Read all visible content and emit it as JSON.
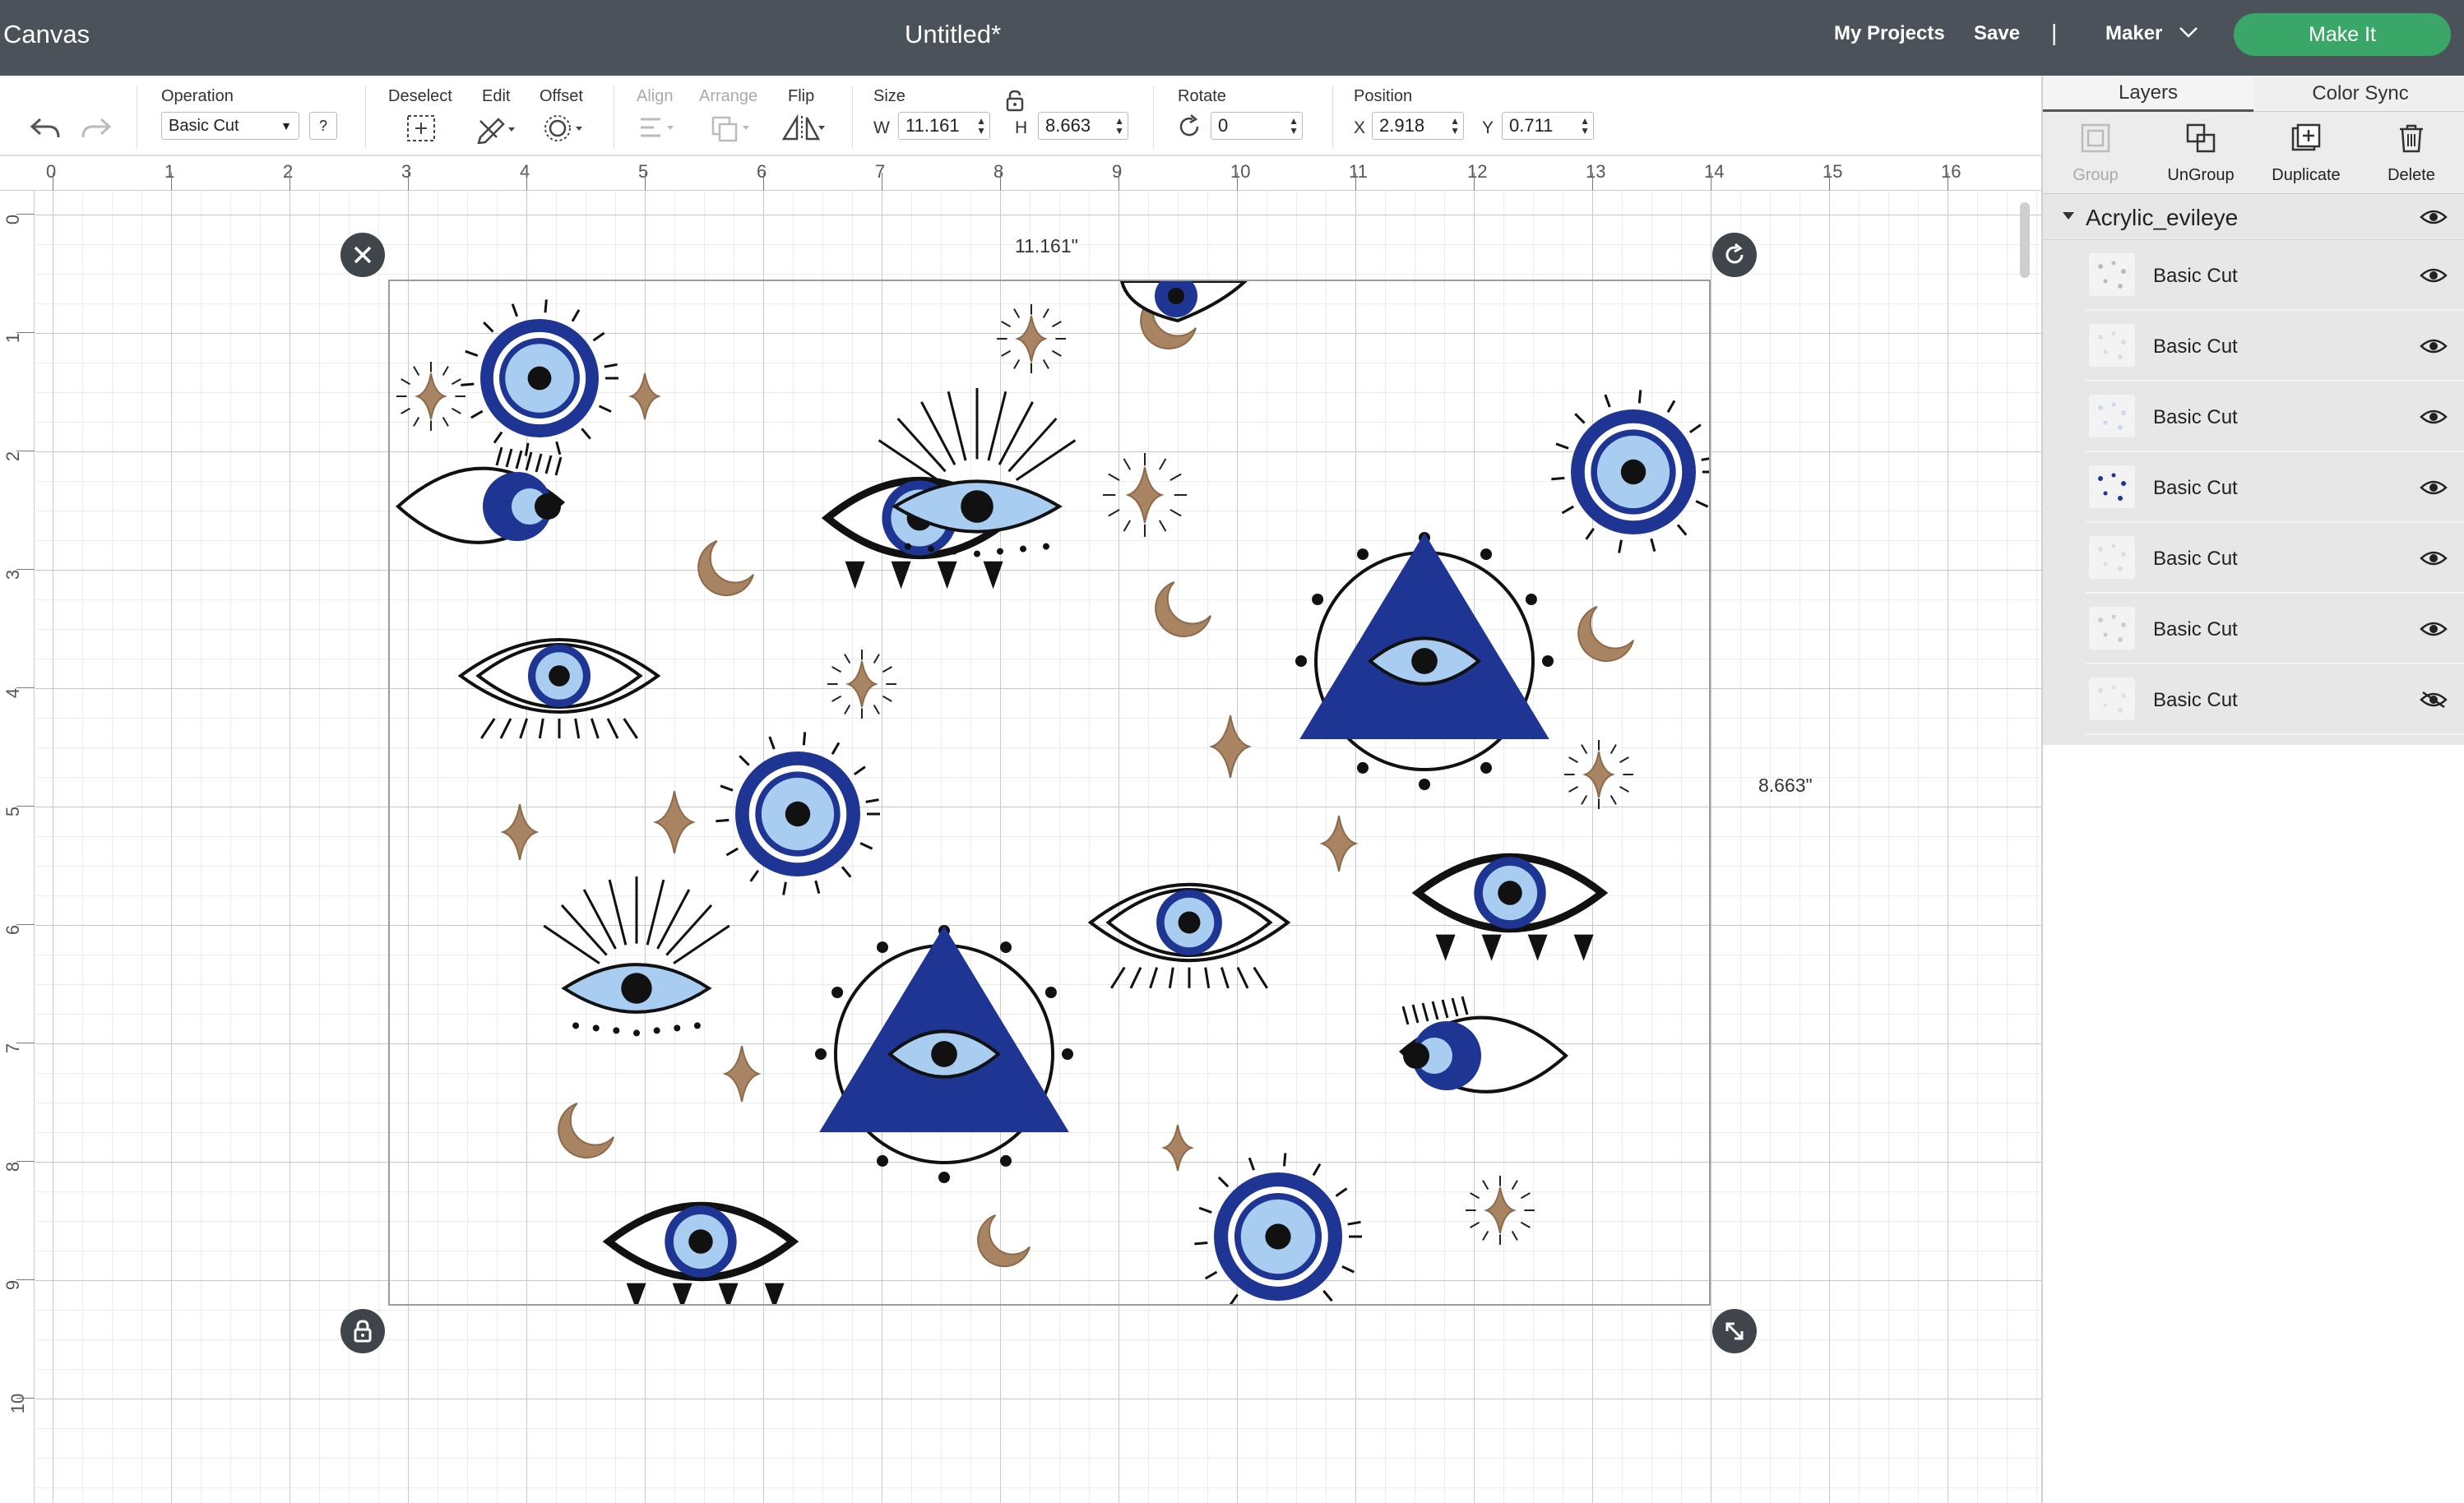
{
  "topbar": {
    "app_name": "Canvas",
    "doc_title": "Untitled*",
    "my_projects": "My Projects",
    "save": "Save",
    "separator": "|",
    "machine": "Maker",
    "make_it": "Make It"
  },
  "toolbar": {
    "operation_label": "Operation",
    "operation_value": "Basic Cut",
    "help": "?",
    "deselect_label": "Deselect",
    "edit_label": "Edit",
    "offset_label": "Offset",
    "align_label": "Align",
    "arrange_label": "Arrange",
    "flip_label": "Flip",
    "size_label": "Size",
    "w_label": "W",
    "w_value": "11.161",
    "h_label": "H",
    "h_value": "8.663",
    "rotate_label": "Rotate",
    "rotate_value": "0",
    "position_label": "Position",
    "x_label": "X",
    "x_value": "2.918",
    "y_label": "Y",
    "y_value": "0.711"
  },
  "rulers": {
    "horizontal": [
      "0",
      "1",
      "2",
      "3",
      "4",
      "5",
      "6",
      "7",
      "8",
      "9",
      "10",
      "11",
      "12",
      "13",
      "14",
      "15",
      "16"
    ],
    "vertical": [
      "0",
      "1",
      "2",
      "3",
      "4",
      "5",
      "6",
      "7",
      "8",
      "9",
      "10"
    ]
  },
  "canvas": {
    "width_dim": "11.161\"",
    "height_dim": "8.663\""
  },
  "panel": {
    "tab_layers": "Layers",
    "tab_color_sync": "Color Sync",
    "group": "Group",
    "ungroup": "UnGroup",
    "duplicate": "Duplicate",
    "delete": "Delete",
    "group_name": "Acrylic_evileye",
    "layers": [
      {
        "name": "Basic Cut",
        "visible": true
      },
      {
        "name": "Basic Cut",
        "visible": true
      },
      {
        "name": "Basic Cut",
        "visible": true
      },
      {
        "name": "Basic Cut",
        "visible": true
      },
      {
        "name": "Basic Cut",
        "visible": true
      },
      {
        "name": "Basic Cut",
        "visible": true
      },
      {
        "name": "Basic Cut",
        "visible": false
      }
    ]
  },
  "colors": {
    "topbar": "#4b5259",
    "make_it": "#3aa768",
    "navy": "#1f3594",
    "light_blue": "#a9cdf0",
    "tan": "#a88463"
  }
}
